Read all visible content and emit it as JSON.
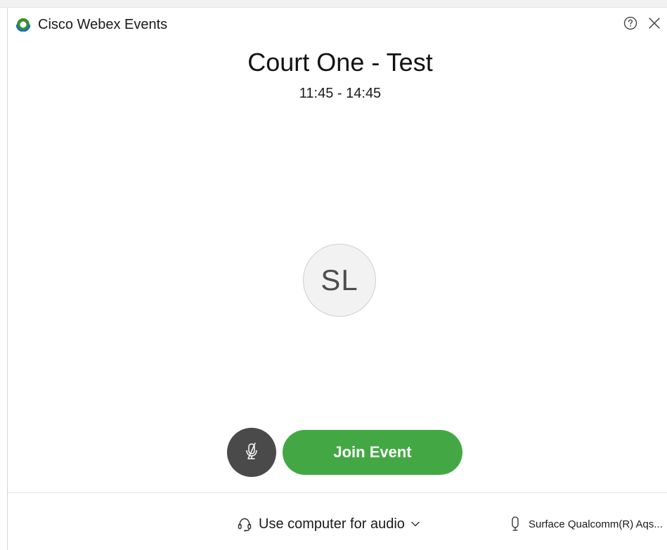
{
  "app": {
    "title": "Cisco Webex Events",
    "logo_icon": "webex-logo-icon",
    "help_icon": "help-icon",
    "close_icon": "close-icon"
  },
  "event": {
    "title": "Court One - Test",
    "time": "11:45 - 14:45"
  },
  "avatar": {
    "initials": "SL"
  },
  "controls": {
    "mute_icon": "microphone-muted-icon",
    "join_label": "Join Event"
  },
  "footer": {
    "audio_label": "Use computer for audio",
    "audio_icon": "headset-icon",
    "mic_device_label": "Surface Qualcomm(R) Aqs...",
    "mic_icon": "microphone-icon"
  },
  "colors": {
    "join_button": "#43a844",
    "mute_button": "#4a4a4a",
    "avatar_bg": "#f2f2f2"
  }
}
